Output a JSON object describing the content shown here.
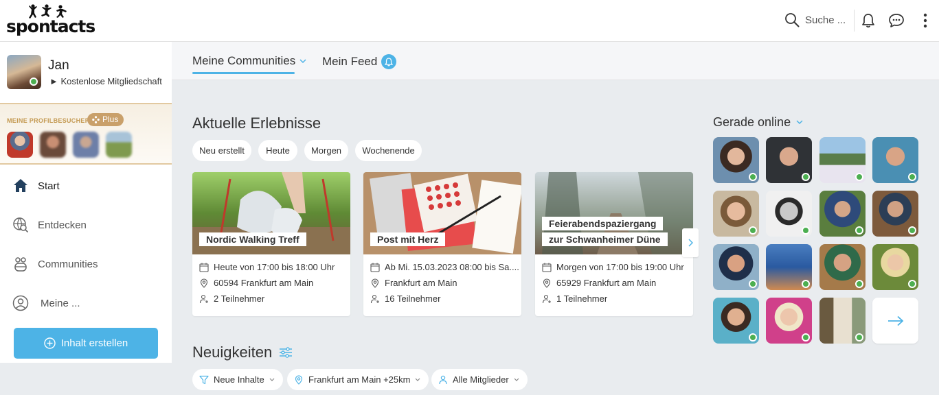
{
  "brand": {
    "name": "spontacts",
    "accent": "#4db3e6",
    "online": "#4caf50"
  },
  "header": {
    "search_label": "Suche ..."
  },
  "profile": {
    "name": "Jan",
    "membership": "► Kostenlose Mitgliedschaft"
  },
  "visitors": {
    "label": "MEINE PROFILBESUCHER",
    "plus_label": "Plus"
  },
  "nav": [
    {
      "label": "Start",
      "icon": "home-icon",
      "active": true
    },
    {
      "label": "Entdecken",
      "icon": "discover-icon"
    },
    {
      "label": "Communities",
      "icon": "communities-icon"
    },
    {
      "label": "Meine ...",
      "icon": "user-icon"
    }
  ],
  "create_button": {
    "label": "Inhalt erstellen"
  },
  "tabs": [
    {
      "label": "Meine Communities",
      "active": true
    },
    {
      "label": "Mein Feed"
    }
  ],
  "experiences": {
    "title": "Aktuelle Erlebnisse",
    "chips": [
      "Neu erstellt",
      "Heute",
      "Morgen",
      "Wochenende"
    ],
    "cards": [
      {
        "title_lines": [
          "Nordic Walking Treff"
        ],
        "date": "Heute von 17:00 bis 18:00 Uhr",
        "location": "60594 Frankfurt am Main",
        "participants": "2 Teilnehmer"
      },
      {
        "title_lines": [
          "Post mit Herz"
        ],
        "date": "Ab Mi. 15.03.2023 08:00 bis Sa....",
        "location": "Frankfurt am Main",
        "participants": "16 Teilnehmer"
      },
      {
        "title_lines": [
          "Feierabendspaziergang",
          "zur Schwanheimer Düne"
        ],
        "date": "Morgen von 17:00 bis 19:00 Uhr",
        "location": "65929 Frankfurt am Main",
        "participants": "1 Teilnehmer"
      }
    ]
  },
  "online": {
    "title": "Gerade online"
  },
  "news": {
    "title": "Neuigkeiten",
    "filters": [
      "Neue Inhalte",
      "Frankfurt am Main +25km",
      "Alle Mitglieder"
    ]
  }
}
